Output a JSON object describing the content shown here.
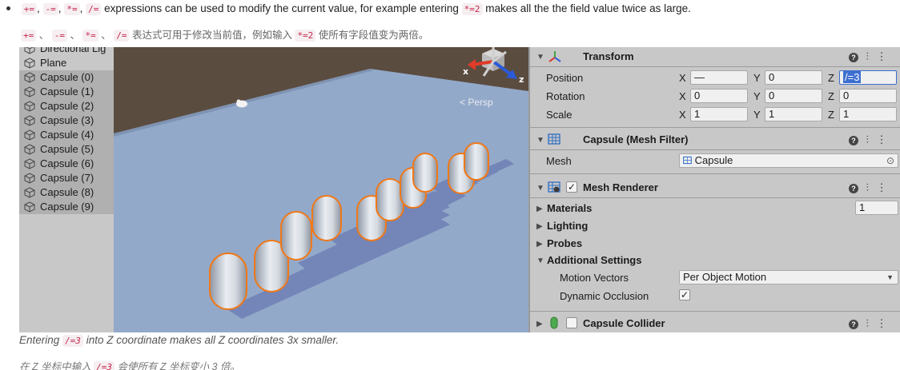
{
  "doc": {
    "line1": {
      "ops": [
        "+=",
        "-=",
        "*=",
        "/="
      ],
      "seps": [
        ",",
        ",",
        ","
      ],
      "text_a": "expressions can be used to modify the current value, for example entering",
      "example_code": "*=2",
      "text_b": "makes all the the field value twice as large."
    },
    "line2": {
      "ops": [
        "+=",
        "-=",
        "*=",
        "/="
      ],
      "seps": [
        "、",
        "、",
        "、"
      ],
      "text_a": "表达式可用于修改当前值，例如输入",
      "example_code": "*=2",
      "text_b": "使所有字段值变为两倍。"
    },
    "caption_en": {
      "pre": "Entering",
      "code": "/=3",
      "post": "into Z coordinate makes all Z coordinates 3x smaller."
    },
    "caption_zh": {
      "pre": "在 Z 坐标中输入",
      "code": "/=3",
      "post": "会使所有 Z 坐标变小 3 倍。"
    }
  },
  "hierarchy": {
    "items": [
      {
        "label": "Directional Lig",
        "selected": false
      },
      {
        "label": "Plane",
        "selected": false
      },
      {
        "label": "Capsule (0)",
        "selected": true
      },
      {
        "label": "Capsule (1)",
        "selected": true
      },
      {
        "label": "Capsule (2)",
        "selected": true
      },
      {
        "label": "Capsule (3)",
        "selected": true
      },
      {
        "label": "Capsule (4)",
        "selected": true
      },
      {
        "label": "Capsule (5)",
        "selected": true
      },
      {
        "label": "Capsule (6)",
        "selected": true
      },
      {
        "label": "Capsule (7)",
        "selected": true
      },
      {
        "label": "Capsule (8)",
        "selected": true
      },
      {
        "label": "Capsule (9)",
        "selected": true
      }
    ]
  },
  "scene": {
    "projection_label": "< Persp",
    "gizmo": {
      "x": "x",
      "z": "z"
    }
  },
  "inspector": {
    "transform": {
      "title": "Transform",
      "position": {
        "label": "Position",
        "x_axis": "X",
        "x": "—",
        "y_axis": "Y",
        "y": "0",
        "z_axis": "Z",
        "z": "/=3"
      },
      "rotation": {
        "label": "Rotation",
        "x_axis": "X",
        "x": "0",
        "y_axis": "Y",
        "y": "0",
        "z_axis": "Z",
        "z": "0"
      },
      "scale": {
        "label": "Scale",
        "x_axis": "X",
        "x": "1",
        "y_axis": "Y",
        "y": "1",
        "z_axis": "Z",
        "z": "1"
      }
    },
    "mesh_filter": {
      "title": "Capsule (Mesh Filter)",
      "mesh_label": "Mesh",
      "mesh_value": "Capsule"
    },
    "mesh_renderer": {
      "title": "Mesh Renderer",
      "enabled": true,
      "materials": "Materials",
      "materials_count": "1",
      "lighting": "Lighting",
      "probes": "Probes",
      "additional": "Additional Settings",
      "motion_vectors_label": "Motion Vectors",
      "motion_vectors_value": "Per Object Motion",
      "dynamic_occlusion_label": "Dynamic Occlusion",
      "dynamic_occlusion": true
    },
    "capsule_collider": {
      "title": "Capsule Collider",
      "enabled": false
    }
  },
  "colors": {
    "accent_selection": "#3d6fcf",
    "capsule_outline": "#f07818",
    "ground": "#93a9c9",
    "sky": "#5b4c40"
  }
}
